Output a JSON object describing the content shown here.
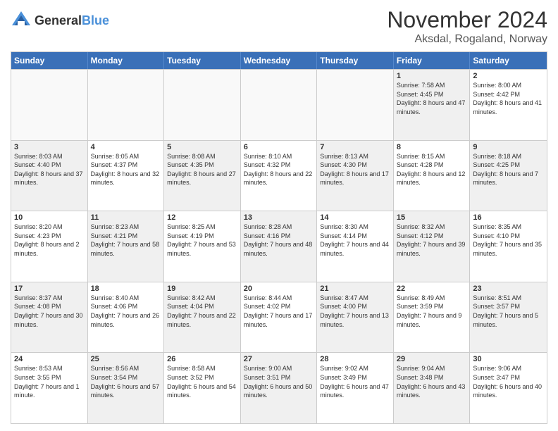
{
  "header": {
    "logo_general": "General",
    "logo_blue": "Blue",
    "title": "November 2024",
    "subtitle": "Aksdal, Rogaland, Norway"
  },
  "weekdays": [
    "Sunday",
    "Monday",
    "Tuesday",
    "Wednesday",
    "Thursday",
    "Friday",
    "Saturday"
  ],
  "rows": [
    [
      {
        "day": "",
        "text": "",
        "empty": true
      },
      {
        "day": "",
        "text": "",
        "empty": true
      },
      {
        "day": "",
        "text": "",
        "empty": true
      },
      {
        "day": "",
        "text": "",
        "empty": true
      },
      {
        "day": "",
        "text": "",
        "empty": true
      },
      {
        "day": "1",
        "text": "Sunrise: 7:58 AM\nSunset: 4:45 PM\nDaylight: 8 hours and 47 minutes.",
        "shaded": true
      },
      {
        "day": "2",
        "text": "Sunrise: 8:00 AM\nSunset: 4:42 PM\nDaylight: 8 hours and 41 minutes.",
        "shaded": false
      }
    ],
    [
      {
        "day": "3",
        "text": "Sunrise: 8:03 AM\nSunset: 4:40 PM\nDaylight: 8 hours and 37 minutes.",
        "shaded": true
      },
      {
        "day": "4",
        "text": "Sunrise: 8:05 AM\nSunset: 4:37 PM\nDaylight: 8 hours and 32 minutes.",
        "shaded": false
      },
      {
        "day": "5",
        "text": "Sunrise: 8:08 AM\nSunset: 4:35 PM\nDaylight: 8 hours and 27 minutes.",
        "shaded": true
      },
      {
        "day": "6",
        "text": "Sunrise: 8:10 AM\nSunset: 4:32 PM\nDaylight: 8 hours and 22 minutes.",
        "shaded": false
      },
      {
        "day": "7",
        "text": "Sunrise: 8:13 AM\nSunset: 4:30 PM\nDaylight: 8 hours and 17 minutes.",
        "shaded": true
      },
      {
        "day": "8",
        "text": "Sunrise: 8:15 AM\nSunset: 4:28 PM\nDaylight: 8 hours and 12 minutes.",
        "shaded": false
      },
      {
        "day": "9",
        "text": "Sunrise: 8:18 AM\nSunset: 4:25 PM\nDaylight: 8 hours and 7 minutes.",
        "shaded": true
      }
    ],
    [
      {
        "day": "10",
        "text": "Sunrise: 8:20 AM\nSunset: 4:23 PM\nDaylight: 8 hours and 2 minutes.",
        "shaded": false
      },
      {
        "day": "11",
        "text": "Sunrise: 8:23 AM\nSunset: 4:21 PM\nDaylight: 7 hours and 58 minutes.",
        "shaded": true
      },
      {
        "day": "12",
        "text": "Sunrise: 8:25 AM\nSunset: 4:19 PM\nDaylight: 7 hours and 53 minutes.",
        "shaded": false
      },
      {
        "day": "13",
        "text": "Sunrise: 8:28 AM\nSunset: 4:16 PM\nDaylight: 7 hours and 48 minutes.",
        "shaded": true
      },
      {
        "day": "14",
        "text": "Sunrise: 8:30 AM\nSunset: 4:14 PM\nDaylight: 7 hours and 44 minutes.",
        "shaded": false
      },
      {
        "day": "15",
        "text": "Sunrise: 8:32 AM\nSunset: 4:12 PM\nDaylight: 7 hours and 39 minutes.",
        "shaded": true
      },
      {
        "day": "16",
        "text": "Sunrise: 8:35 AM\nSunset: 4:10 PM\nDaylight: 7 hours and 35 minutes.",
        "shaded": false
      }
    ],
    [
      {
        "day": "17",
        "text": "Sunrise: 8:37 AM\nSunset: 4:08 PM\nDaylight: 7 hours and 30 minutes.",
        "shaded": true
      },
      {
        "day": "18",
        "text": "Sunrise: 8:40 AM\nSunset: 4:06 PM\nDaylight: 7 hours and 26 minutes.",
        "shaded": false
      },
      {
        "day": "19",
        "text": "Sunrise: 8:42 AM\nSunset: 4:04 PM\nDaylight: 7 hours and 22 minutes.",
        "shaded": true
      },
      {
        "day": "20",
        "text": "Sunrise: 8:44 AM\nSunset: 4:02 PM\nDaylight: 7 hours and 17 minutes.",
        "shaded": false
      },
      {
        "day": "21",
        "text": "Sunrise: 8:47 AM\nSunset: 4:00 PM\nDaylight: 7 hours and 13 minutes.",
        "shaded": true
      },
      {
        "day": "22",
        "text": "Sunrise: 8:49 AM\nSunset: 3:59 PM\nDaylight: 7 hours and 9 minutes.",
        "shaded": false
      },
      {
        "day": "23",
        "text": "Sunrise: 8:51 AM\nSunset: 3:57 PM\nDaylight: 7 hours and 5 minutes.",
        "shaded": true
      }
    ],
    [
      {
        "day": "24",
        "text": "Sunrise: 8:53 AM\nSunset: 3:55 PM\nDaylight: 7 hours and 1 minute.",
        "shaded": false
      },
      {
        "day": "25",
        "text": "Sunrise: 8:56 AM\nSunset: 3:54 PM\nDaylight: 6 hours and 57 minutes.",
        "shaded": true
      },
      {
        "day": "26",
        "text": "Sunrise: 8:58 AM\nSunset: 3:52 PM\nDaylight: 6 hours and 54 minutes.",
        "shaded": false
      },
      {
        "day": "27",
        "text": "Sunrise: 9:00 AM\nSunset: 3:51 PM\nDaylight: 6 hours and 50 minutes.",
        "shaded": true
      },
      {
        "day": "28",
        "text": "Sunrise: 9:02 AM\nSunset: 3:49 PM\nDaylight: 6 hours and 47 minutes.",
        "shaded": false
      },
      {
        "day": "29",
        "text": "Sunrise: 9:04 AM\nSunset: 3:48 PM\nDaylight: 6 hours and 43 minutes.",
        "shaded": true
      },
      {
        "day": "30",
        "text": "Sunrise: 9:06 AM\nSunset: 3:47 PM\nDaylight: 6 hours and 40 minutes.",
        "shaded": false
      }
    ]
  ]
}
